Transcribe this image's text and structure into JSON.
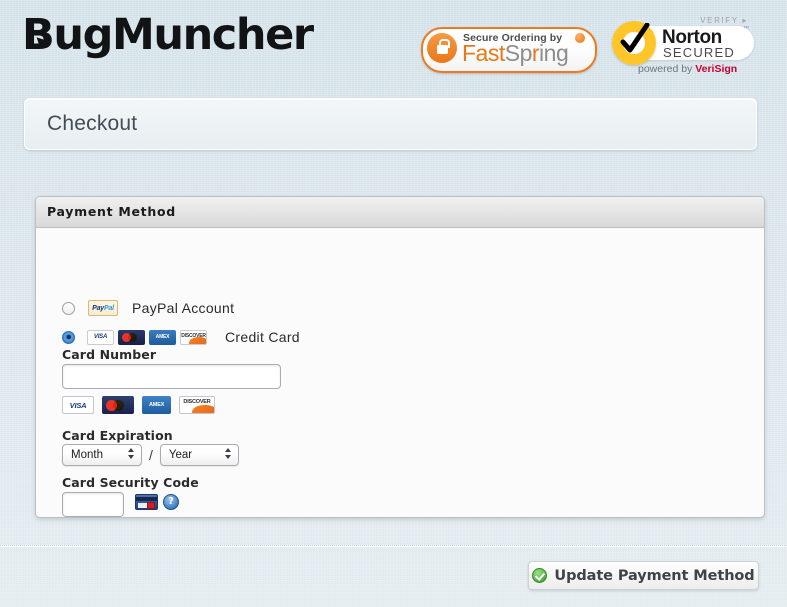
{
  "brand": {
    "logo_text": "BugMuncher"
  },
  "badges": {
    "fastspring": {
      "top_text": "Secure Ordering by",
      "name_fast": "Fast",
      "name_sp": "Sp",
      "name_r": "r",
      "name_ing": "ing",
      "trademark": "®",
      "lock_icon": "lock-icon"
    },
    "norton": {
      "verify": "VERIFY ▸",
      "name": "Norton",
      "subtitle": "SECURED",
      "trademark": "™",
      "powered_prefix": "powered by ",
      "powered_brand": "VeriSign",
      "check_icon": "checkmark-icon"
    }
  },
  "page": {
    "title": "Checkout"
  },
  "payment_panel": {
    "header": "Payment Method",
    "options": [
      {
        "id": "paypal",
        "label": "PayPal Account",
        "selected": false,
        "logo": "paypal-logo",
        "logo_text_1": "Pay",
        "logo_text_2": "Pal"
      },
      {
        "id": "credit-card",
        "label": "Credit Card",
        "selected": true,
        "card_logos": [
          "VISA",
          "MasterCard",
          "AMEX",
          "DISCOVER"
        ]
      }
    ],
    "card_number": {
      "label": "Card Number",
      "value": "",
      "placeholder": ""
    },
    "accepted_cards": [
      {
        "name": "VISA",
        "text": "VISA"
      },
      {
        "name": "MasterCard",
        "text": ""
      },
      {
        "name": "AMEX",
        "text": "AMEX"
      },
      {
        "name": "DISCOVER",
        "text": "DISCOVER"
      }
    ],
    "card_expiration": {
      "label": "Card Expiration",
      "month_value": "Month",
      "year_value": "Year",
      "separator": "/"
    },
    "card_security_code": {
      "label": "Card Security Code",
      "value": "",
      "placeholder": "",
      "card_back_icon": "card-back-cvv-icon",
      "help_icon": "help-question-icon",
      "help_glyph": "?"
    }
  },
  "footer": {
    "update_button": {
      "label": "Update Payment Method",
      "icon": "green-check-circle-icon"
    }
  },
  "colors": {
    "page_background": "#d9e5eb",
    "accent_orange": "#ea7718",
    "norton_yellow": "#ffc629",
    "verisign_red": "#cc0033",
    "radio_selected": "#2b6cb8",
    "button_check_green": "#4caf3d"
  }
}
